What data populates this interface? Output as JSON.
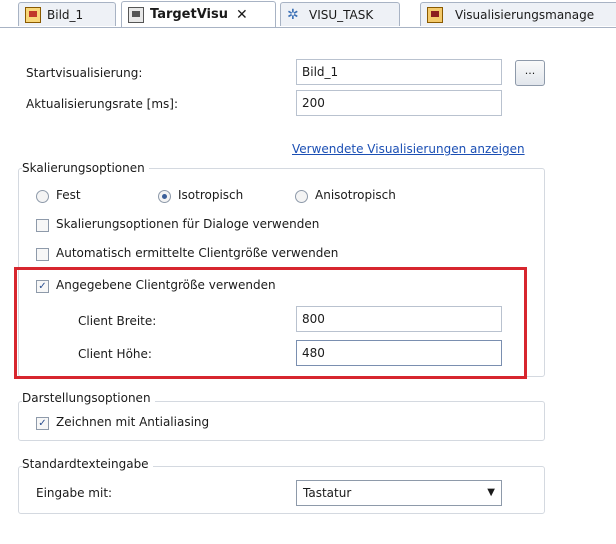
{
  "tabs": [
    {
      "label": "Bild_1",
      "icon": "visualization-icon"
    },
    {
      "label": "TargetVisu",
      "icon": "target-visu-icon",
      "active": true,
      "close": "✕"
    },
    {
      "label": "VISU_TASK",
      "icon": "task-icon"
    },
    {
      "label": "Visualisierungsmanage",
      "icon": "vis-manager-icon"
    }
  ],
  "form": {
    "start_label": "Startvisualisierung:",
    "start_value": "Bild_1",
    "browse_label": "...",
    "rate_label": "Aktualisierungsrate [ms]:",
    "rate_value": "200",
    "used_link": "Verwendete Visualisierungen anzeigen"
  },
  "scaling": {
    "title": "Skalierungsoptionen",
    "radio_fixed": "Fest",
    "radio_iso": "Isotropisch",
    "radio_aniso": "Anisotropisch",
    "selected": "Isotropisch",
    "dialog_check": "Skalierungsoptionen für Dialoge verwenden",
    "auto_check": "Automatisch ermittelte Clientgröße verwenden",
    "given_check": "Angegebene Clientgröße verwenden",
    "given_checked": true,
    "width_label": "Client Breite:",
    "width_value": "800",
    "height_label": "Client Höhe:",
    "height_value": "480"
  },
  "display": {
    "title": "Darstellungsoptionen",
    "antialias_check": "Zeichnen mit Antialiasing",
    "antialias_checked": true
  },
  "textinput": {
    "title": "Standardtexteingabe",
    "input_label": "Eingabe mit:",
    "input_value": "Tastatur"
  },
  "colors": {
    "highlight": "#d7262e",
    "link": "#1b4fb4"
  }
}
